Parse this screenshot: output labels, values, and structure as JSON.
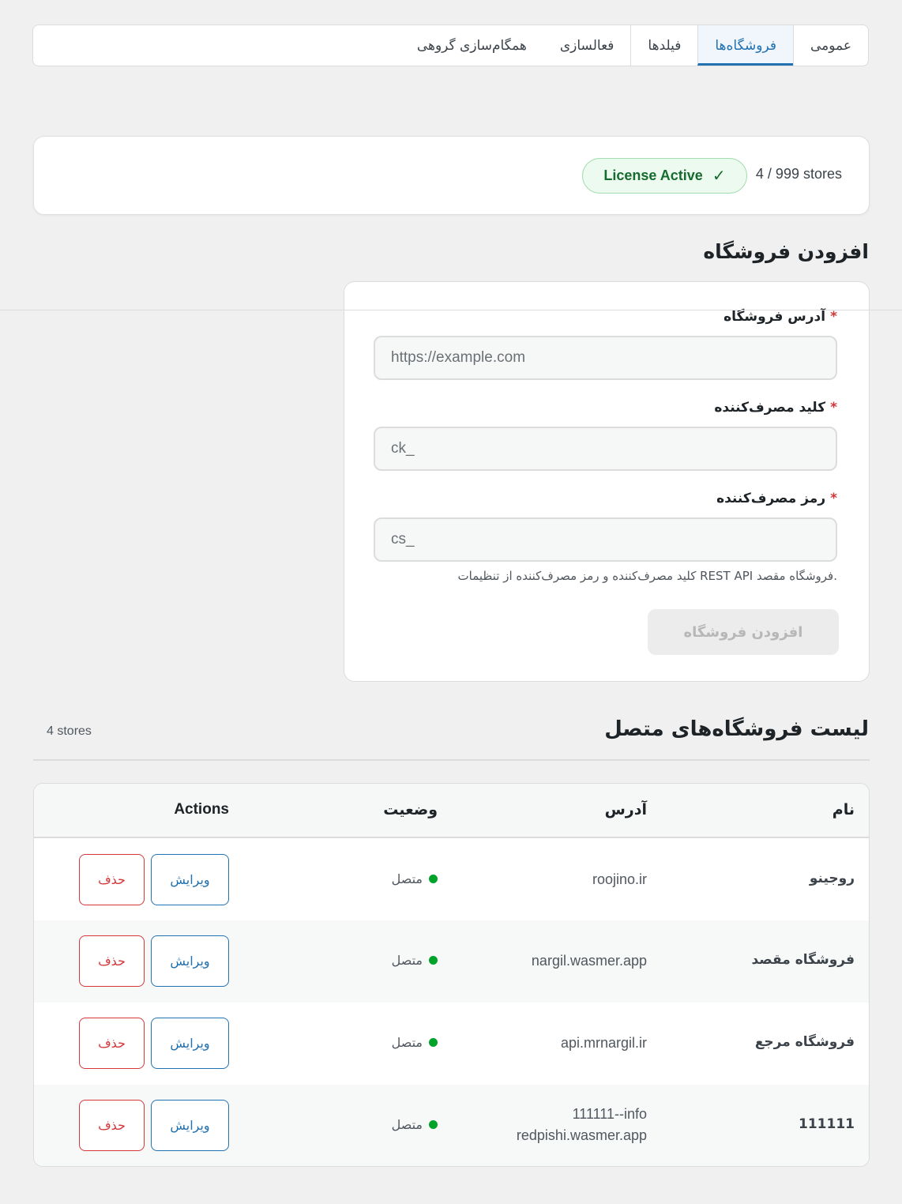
{
  "tabs": [
    {
      "label": "عمومی",
      "active": false
    },
    {
      "label": "فروشگاه‌ها",
      "active": true
    },
    {
      "label": "فیلدها",
      "active": false
    },
    {
      "label": "فعالسازی",
      "active": false
    },
    {
      "label": "همگام‌سازی گروهی",
      "active": false
    }
  ],
  "license": {
    "count_text": "4 / 999 stores",
    "badge_label": "License Active",
    "badge_icon": "✓",
    "badge_color": "#166b2e"
  },
  "add_store": {
    "title": "افزودن فروشگاه",
    "fields": [
      {
        "label": "آدرس فروشگاه",
        "required_mark": "*",
        "placeholder": "https://example.com",
        "value": ""
      },
      {
        "label": "کلید مصرف‌کننده",
        "required_mark": "*",
        "placeholder": "ck_",
        "value": ""
      },
      {
        "label": "رمز مصرف‌کننده",
        "required_mark": "*",
        "placeholder": "cs_",
        "value": ""
      }
    ],
    "help_text": "کلید مصرف‌کننده و رمز مصرف‌کننده از تنظیمات REST API فروشگاه مقصد.",
    "submit_label": "افزودن فروشگاه"
  },
  "store_list": {
    "title": "لیست فروشگاه‌های متصل",
    "count_text": "4 stores",
    "columns": {
      "name": "نام",
      "address": "آدرس",
      "status": "وضعیت",
      "actions": "Actions"
    },
    "rows": [
      {
        "name": "روجینو",
        "address": [
          "roojino.ir"
        ],
        "status": "متصل",
        "edit_label": "ویرایش",
        "delete_label": "حذف"
      },
      {
        "name": "فروشگاه مقصد",
        "address": [
          "nargil.wasmer.app"
        ],
        "status": "متصل",
        "edit_label": "ویرایش",
        "delete_label": "حذف"
      },
      {
        "name": "فروشگاه مرجع",
        "address": [
          "api.mrnargil.ir"
        ],
        "status": "متصل",
        "edit_label": "ویرایش",
        "delete_label": "حذف"
      },
      {
        "name": "111111",
        "address": [
          "111111--info",
          "redpishi.wasmer.app"
        ],
        "status": "متصل",
        "edit_label": "ویرایش",
        "delete_label": "حذف"
      }
    ]
  },
  "colors": {
    "accent": "#2271b1",
    "danger": "#d63638",
    "connected": "#00a32a"
  }
}
